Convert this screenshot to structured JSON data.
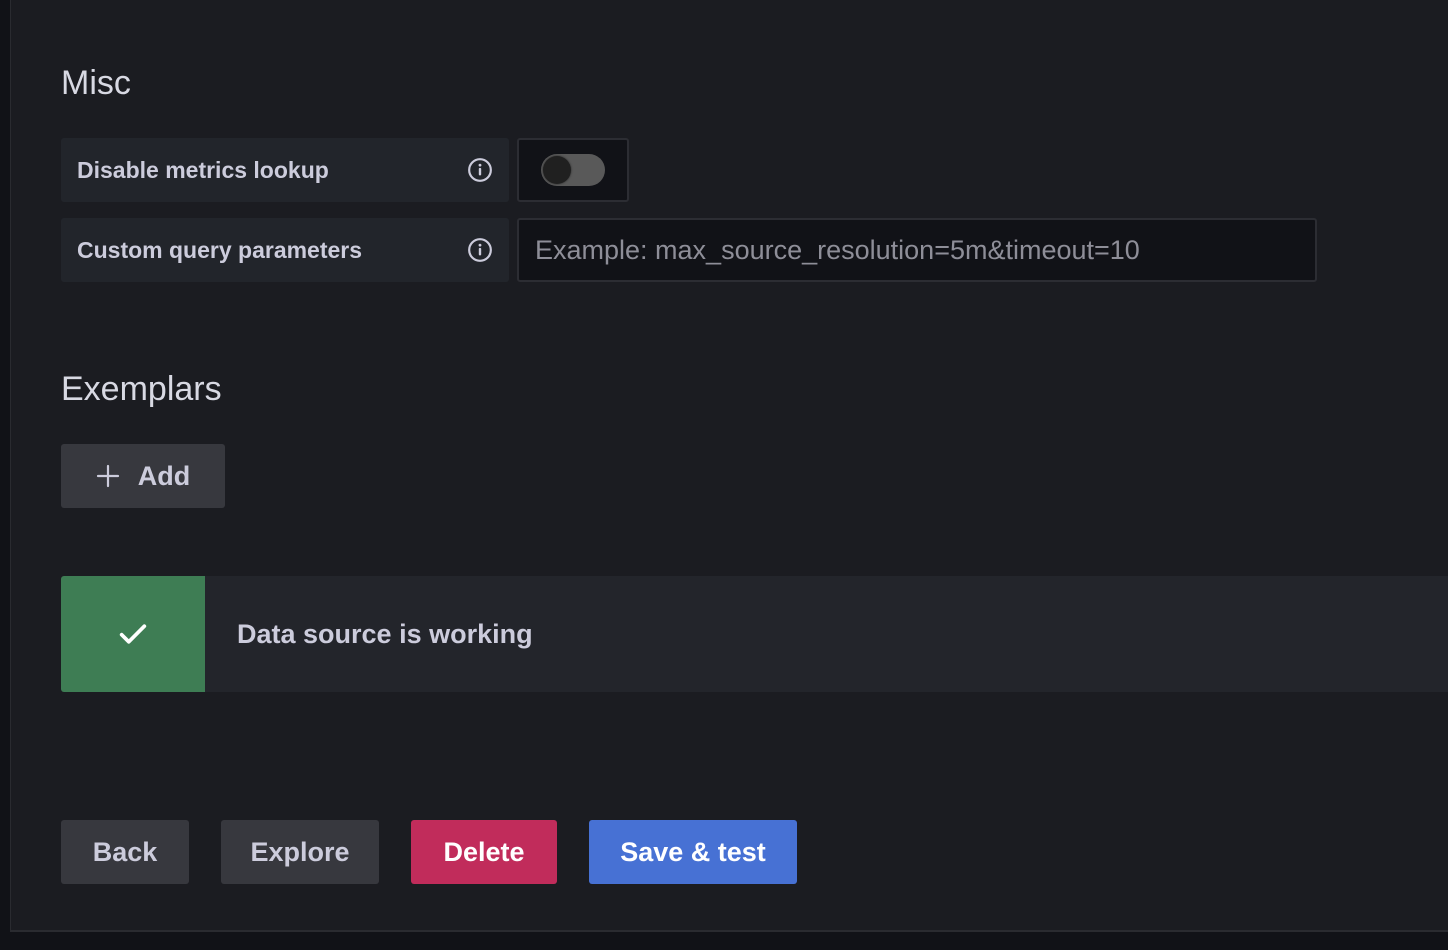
{
  "misc": {
    "heading": "Misc",
    "disable_metrics_lookup": {
      "label": "Disable metrics lookup",
      "info_icon": "info-circle-icon",
      "enabled": false
    },
    "custom_query_parameters": {
      "label": "Custom query parameters",
      "info_icon": "info-circle-icon",
      "value": "",
      "placeholder": "Example: max_source_resolution=5m&timeout=10"
    }
  },
  "exemplars": {
    "heading": "Exemplars",
    "add_button": {
      "icon": "plus-icon",
      "label": "Add"
    }
  },
  "status_alert": {
    "icon": "check-icon",
    "message": "Data source is working",
    "color": "#3e7d54"
  },
  "actions": {
    "back": "Back",
    "explore": "Explore",
    "delete": "Delete",
    "save_test": "Save & test",
    "colors": {
      "secondary": "#37383e",
      "danger": "#c12c5b",
      "primary": "#4771d4"
    }
  }
}
